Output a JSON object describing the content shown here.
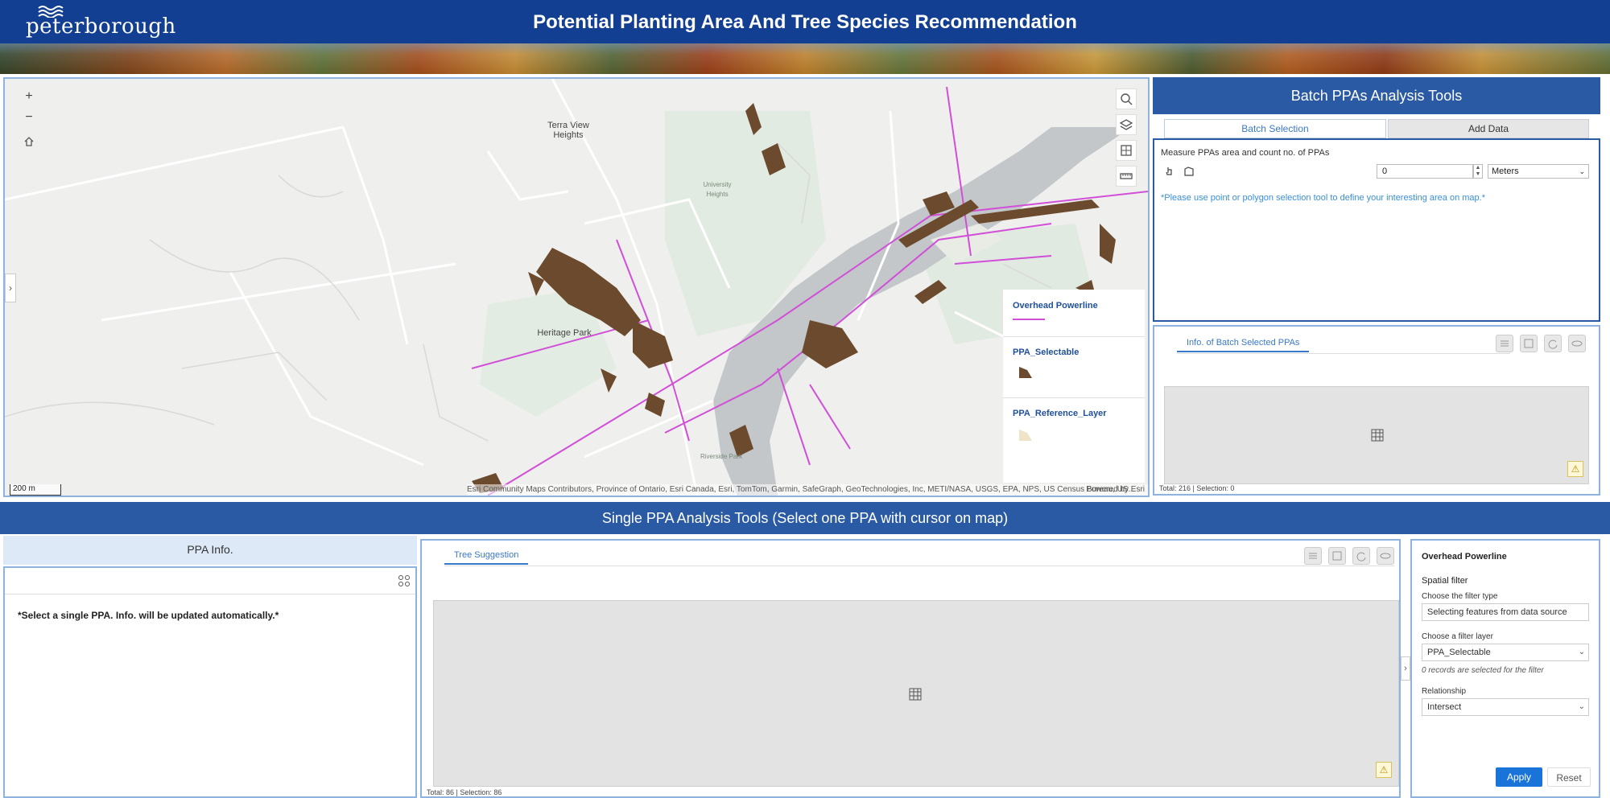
{
  "header": {
    "logo_text": "peterborough",
    "title": "Potential Planting Area And Tree Species Recommendation"
  },
  "map": {
    "zoom_in": "+",
    "zoom_out": "−",
    "scale": "200 m",
    "attribution": "Esri Community Maps Contributors, Province of Ontario, Esri Canada, Esri, TomTom, Garmin, SafeGraph, GeoTechnologies, Inc, METI/NASA, USGS, EPA, NPS, US Census Bureau, US...",
    "powered_by": "Powered by Esri",
    "labels": {
      "terra_view": "Terra View Heights",
      "university": "University Heights",
      "heritage": "Heritage Park",
      "riverside": "Riverside Park"
    },
    "legend": [
      {
        "name": "Overhead Powerline",
        "color": "#d14fd8"
      },
      {
        "name": "PPA_Selectable",
        "color": "#6b4a2e"
      },
      {
        "name": "PPA_Reference_Layer",
        "color": "#efe3c8"
      }
    ]
  },
  "batch": {
    "title": "Batch PPAs Analysis Tools",
    "tabs": [
      "Batch Selection",
      "Add Data"
    ],
    "measure_label": "Measure PPAs area and count no. of PPAs",
    "buffer_value": "0",
    "unit": "Meters",
    "hint": "*Please use point or polygon selection tool to define your interesting area on map.*",
    "table_tab": "Info. of Batch Selected PPAs",
    "totals": "Total: 216 | Selection: 0"
  },
  "single": {
    "title": "Single PPA Analysis Tools (Select one PPA with cursor on map)",
    "ppa_info_title": "PPA Info.",
    "ppa_message": "*Select a single PPA. Info. will be updated automatically.*",
    "tree_tab": "Tree Suggestion",
    "tree_totals": "Total: 86 | Selection: 86"
  },
  "filter": {
    "layer_title": "Overhead Powerline",
    "section": "Spatial filter",
    "type_label": "Choose the filter type",
    "type_value": "Selecting features from data source",
    "layer_label": "Choose a filter layer",
    "layer_value": "PPA_Selectable",
    "records_note": "0 records are selected for the filter",
    "relationship_label": "Relationship",
    "relationship_value": "Intersect",
    "apply": "Apply",
    "reset": "Reset"
  }
}
